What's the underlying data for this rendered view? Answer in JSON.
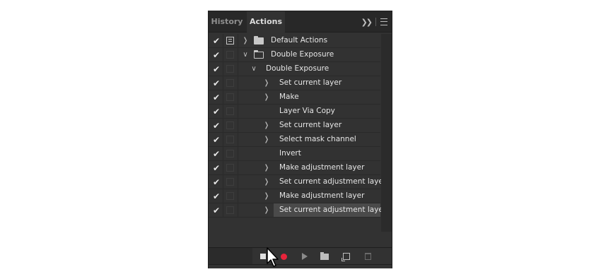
{
  "tabs": [
    {
      "label": "History",
      "active": false
    },
    {
      "label": "Actions",
      "active": true
    }
  ],
  "tab_icons": {
    "expand": "double-chevron-right-icon",
    "menu": "panel-menu-icon"
  },
  "rows": [
    {
      "label": "Default Actions",
      "checked": true,
      "dialog": "active",
      "level": 0,
      "toggle": "closed",
      "folder": "closed"
    },
    {
      "label": "Double Exposure",
      "checked": true,
      "dialog": "empty",
      "level": 0,
      "toggle": "open",
      "folder": "open"
    },
    {
      "label": "Double Exposure",
      "checked": true,
      "dialog": "empty",
      "level": 1,
      "toggle": "open",
      "folder": ""
    },
    {
      "label": "Set current layer",
      "checked": true,
      "dialog": "empty",
      "level": 2,
      "toggle": "closed",
      "folder": ""
    },
    {
      "label": "Make",
      "checked": true,
      "dialog": "empty",
      "level": 2,
      "toggle": "closed",
      "folder": ""
    },
    {
      "label": "Layer Via Copy",
      "checked": true,
      "dialog": "empty",
      "level": 2,
      "toggle": "",
      "folder": ""
    },
    {
      "label": "Set current layer",
      "checked": true,
      "dialog": "empty",
      "level": 2,
      "toggle": "closed",
      "folder": ""
    },
    {
      "label": "Select mask channel",
      "checked": true,
      "dialog": "empty",
      "level": 2,
      "toggle": "closed",
      "folder": ""
    },
    {
      "label": "Invert",
      "checked": true,
      "dialog": "empty",
      "level": 2,
      "toggle": "",
      "folder": ""
    },
    {
      "label": "Make adjustment layer",
      "checked": true,
      "dialog": "empty",
      "level": 2,
      "toggle": "closed",
      "folder": ""
    },
    {
      "label": "Set current adjustment layer",
      "checked": true,
      "dialog": "empty",
      "level": 2,
      "toggle": "closed",
      "folder": ""
    },
    {
      "label": "Make adjustment layer",
      "checked": true,
      "dialog": "empty",
      "level": 2,
      "toggle": "closed",
      "folder": ""
    },
    {
      "label": "Set current adjustment layer",
      "checked": true,
      "dialog": "empty",
      "level": 2,
      "toggle": "closed",
      "folder": "",
      "selected": true
    }
  ],
  "bottom_buttons": [
    {
      "name": "stop-recording-button",
      "icon": "stop-icon"
    },
    {
      "name": "begin-recording-button",
      "icon": "record-icon"
    },
    {
      "name": "play-selection-button",
      "icon": "play-icon"
    },
    {
      "name": "create-new-set-button",
      "icon": "folder-icon"
    },
    {
      "name": "create-new-action-button",
      "icon": "new-item-icon"
    },
    {
      "name": "delete-button",
      "icon": "trash-icon"
    }
  ],
  "colors": {
    "panel_bg": "#323232",
    "record_red": "#e8243b",
    "selected_row": "#4a4a4a",
    "text": "#e6e6e6"
  }
}
